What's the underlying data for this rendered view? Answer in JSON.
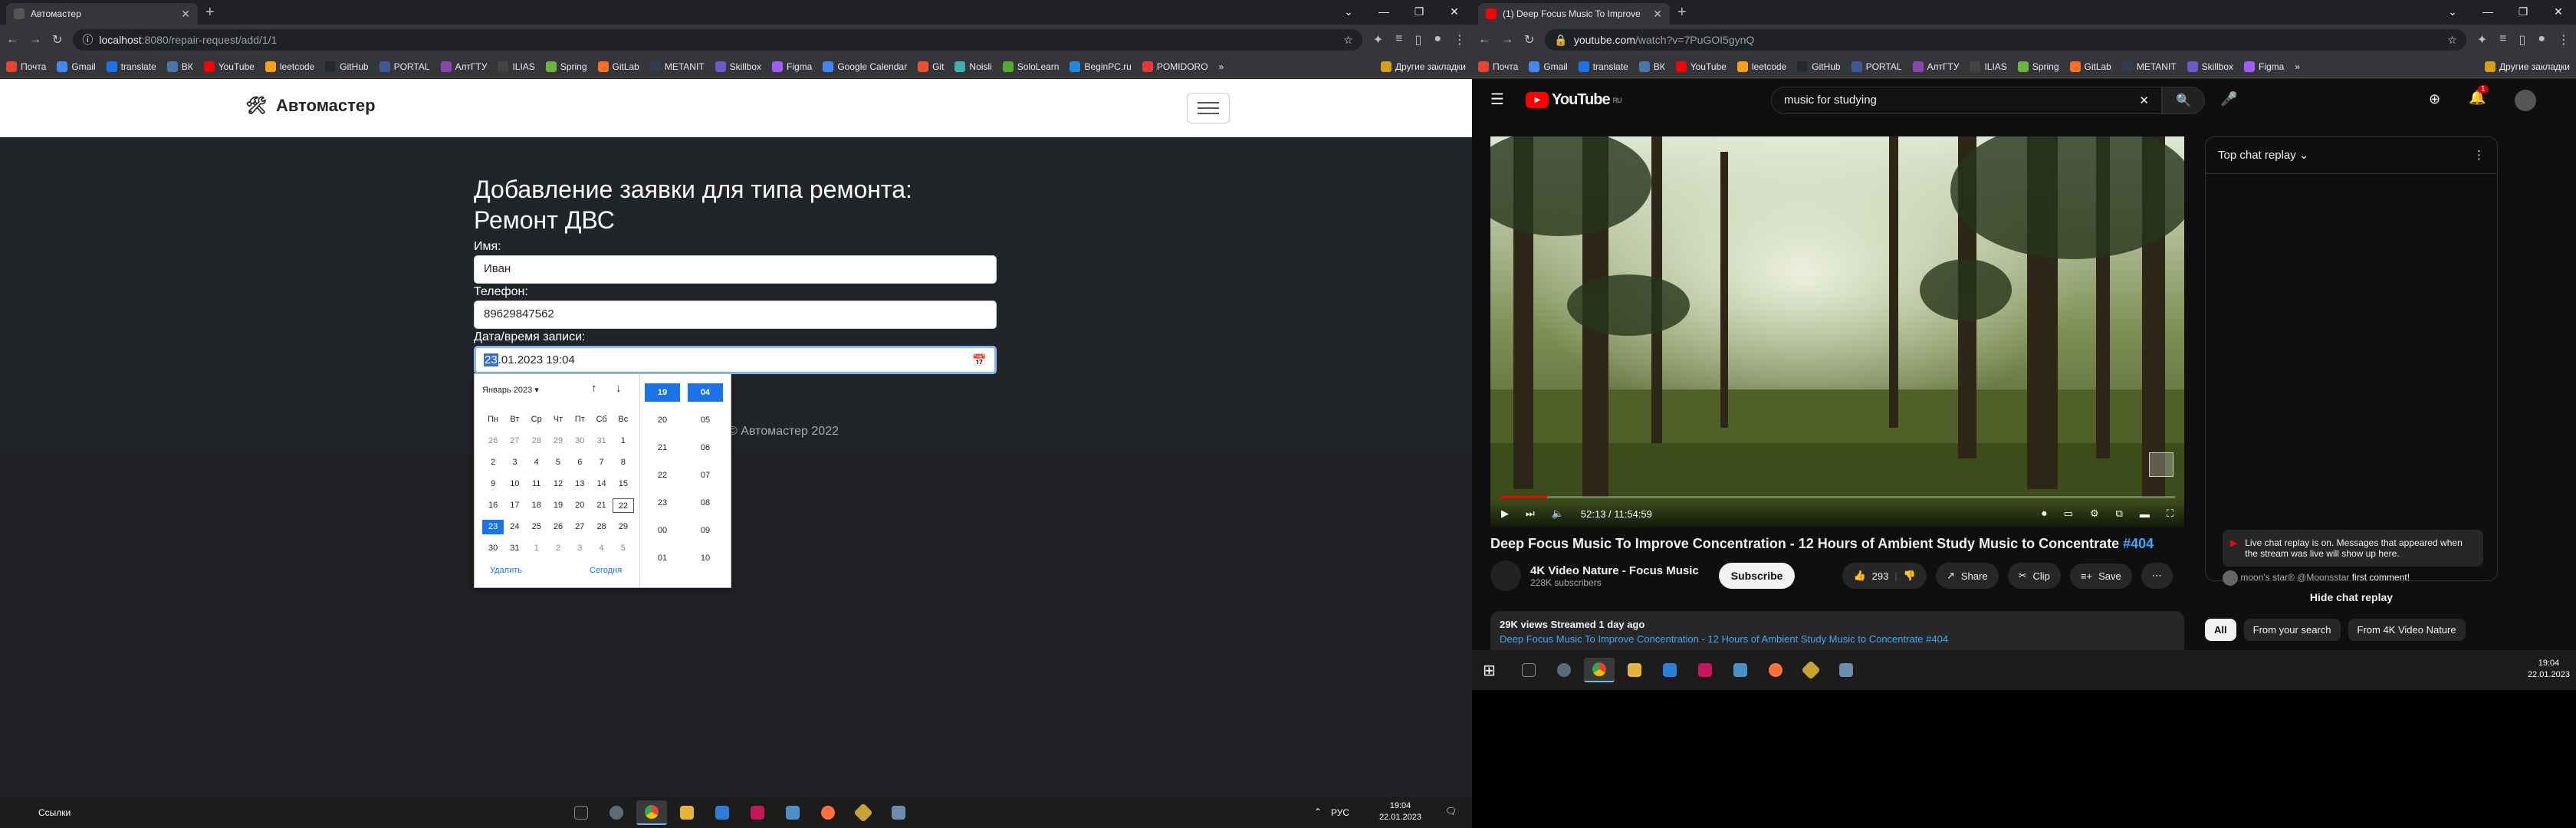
{
  "left": {
    "tab_title": "Автомастер",
    "url_host": "localhost",
    "url_rest": ":8080/repair-request/add/1/1",
    "bookmarks": [
      "Почта",
      "Gmail",
      "translate",
      "ВК",
      "YouTube",
      "leetcode",
      "GitHub",
      "PORTAL",
      "АлтГТУ",
      "ILIAS",
      "Spring",
      "GitLab",
      "METANIT",
      "Skillbox",
      "Figma",
      "Google Calendar",
      "Git",
      "Noisli",
      "SoloLearn",
      "BeginPC.ru",
      "POMIDORO"
    ],
    "other_bookmarks": "Другие закладки",
    "site": {
      "brand": "Автомастер",
      "heading": "Добавление заявки для типа ремонта: Ремонт ДВС",
      "name_label": "Имя:",
      "name_value": "Иван",
      "phone_label": "Телефон:",
      "phone_value": "89629847562",
      "date_label": "Дата/время записи:",
      "date_sel": "23",
      "date_rest": ".01.2023 19:04",
      "footer": "© Автомастер 2022"
    },
    "calendar": {
      "month": "Январь 2023",
      "weekdays": [
        "Пн",
        "Вт",
        "Ср",
        "Чт",
        "Пт",
        "Сб",
        "Вс"
      ],
      "days": [
        [
          "26",
          "27",
          "28",
          "29",
          "30",
          "31",
          "1"
        ],
        [
          "2",
          "3",
          "4",
          "5",
          "6",
          "7",
          "8"
        ],
        [
          "9",
          "10",
          "11",
          "12",
          "13",
          "14",
          "15"
        ],
        [
          "16",
          "17",
          "18",
          "19",
          "20",
          "21",
          "22"
        ],
        [
          "23",
          "24",
          "25",
          "26",
          "27",
          "28",
          "29"
        ],
        [
          "30",
          "31",
          "1",
          "2",
          "3",
          "4",
          "5"
        ]
      ],
      "hours": [
        "19",
        "20",
        "21",
        "22",
        "23",
        "00",
        "01"
      ],
      "minutes": [
        "04",
        "05",
        "06",
        "07",
        "08",
        "09",
        "10"
      ],
      "delete_label": "Удалить",
      "today_label": "Сегодня"
    },
    "taskbar": {
      "links": "Ссылки",
      "lang": "РУС",
      "time": "19:04",
      "date": "22.01.2023"
    }
  },
  "right": {
    "tab_title": "(1) Deep Focus Music To Improve",
    "url_host": "youtube.com",
    "url_rest": "/watch?v=7PuGOI5gynQ",
    "other_bookmarks": "Другие закладки",
    "bookmarks": [
      "Почта",
      "Gmail",
      "translate",
      "ВК",
      "YouTube",
      "leetcode",
      "GitHub",
      "PORTAL",
      "АлтГТУ",
      "ILIAS",
      "Spring",
      "GitLab",
      "METANIT",
      "Skillbox",
      "Figma"
    ],
    "yt": {
      "logo": "YouTube",
      "logo_region": "RU",
      "search": "music for studying",
      "notif_count": "1",
      "time": "52:13 / 11:54:59",
      "title": "Deep Focus Music To Improve Concentration - 12 Hours of Ambient Study Music to Concentrate ",
      "title_tag": "#404",
      "channel": "4K Video Nature - Focus Music",
      "subs": "228K subscribers",
      "subscribe": "Subscribe",
      "likes": "293",
      "share": "Share",
      "clip": "Clip",
      "save": "Save",
      "views": "29K views  Streamed 1 day ago",
      "desc_line": "Deep Focus Music To Improve Concentration - 12 Hours of Ambient Study Music to Concentrate #404",
      "chat_title": "Top chat replay",
      "chat_note": "Live chat replay is on. Messages that appeared when the stream was live will show up here.",
      "chat_user": "moon's star® @Moonsstar",
      "chat_msg": "first comment!",
      "hide_chat": "Hide chat replay",
      "chips": [
        "All",
        "From your search",
        "From 4K Video Nature"
      ]
    },
    "taskbar": {
      "time": "19:04",
      "date": "22.01.2023"
    }
  },
  "colors": {
    "accent": "#1a73e8",
    "yt_red": "#ff0000",
    "site_dark": "#212529"
  }
}
